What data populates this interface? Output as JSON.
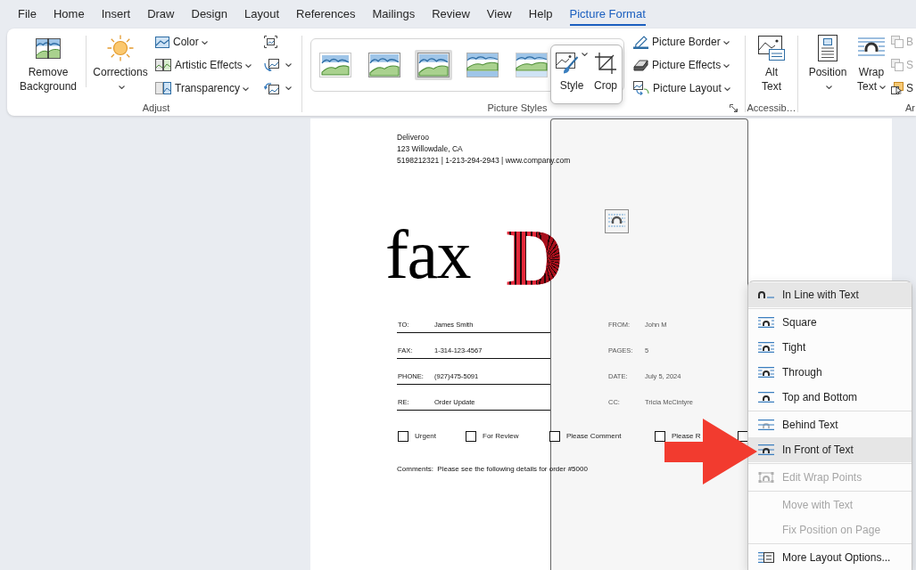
{
  "tabs": [
    {
      "label": "File",
      "selected": false
    },
    {
      "label": "Home",
      "selected": false
    },
    {
      "label": "Insert",
      "selected": false
    },
    {
      "label": "Draw",
      "selected": false
    },
    {
      "label": "Design",
      "selected": false
    },
    {
      "label": "Layout",
      "selected": false
    },
    {
      "label": "References",
      "selected": false
    },
    {
      "label": "Mailings",
      "selected": false
    },
    {
      "label": "Review",
      "selected": false
    },
    {
      "label": "View",
      "selected": false
    },
    {
      "label": "Help",
      "selected": false
    },
    {
      "label": "Picture Format",
      "selected": true
    }
  ],
  "ribbon": {
    "adjust": {
      "title": "Adjust",
      "large_buttons": [
        {
          "label": "Remove Background",
          "dropdown": false
        },
        {
          "label": "Corrections",
          "dropdown": true
        }
      ],
      "small_buttons": [
        {
          "label": "Color",
          "dropdown": true
        },
        {
          "label": "Artistic Effects",
          "dropdown": true
        },
        {
          "label": "Transparency",
          "dropdown": true
        }
      ],
      "icon_buttons": [
        {
          "dropdown": false
        },
        {
          "dropdown": true
        },
        {
          "dropdown": true
        }
      ]
    },
    "picture_styles": {
      "title": "Picture Styles",
      "gallery": [
        {
          "selected": false
        },
        {
          "selected": false
        },
        {
          "selected": true
        },
        {
          "selected": false
        },
        {
          "selected": false
        }
      ],
      "small_buttons": [
        {
          "label": "Picture Border",
          "dropdown": true
        },
        {
          "label": "Picture Effects",
          "dropdown": true
        },
        {
          "label": "Picture Layout",
          "dropdown": true
        }
      ]
    },
    "accessibility": {
      "title": "Accessib…",
      "large_buttons": [
        {
          "label": "Alt Text",
          "dropdown": false
        }
      ]
    },
    "arrange": {
      "title": "Ar",
      "large_buttons": [
        {
          "label": "Position",
          "dropdown": true
        },
        {
          "label": "Wrap Text",
          "dropdown": true
        }
      ],
      "small_buttons": [
        {
          "label": "B",
          "disabled": true
        },
        {
          "label": "S",
          "disabled": true
        },
        {
          "label": "S",
          "disabled": false
        }
      ]
    }
  },
  "quick_popup": {
    "buttons": [
      {
        "label": "Style",
        "dropdown": true
      },
      {
        "label": "Crop",
        "dropdown": false
      }
    ]
  },
  "document": {
    "sender_lines": [
      "Deliveroo",
      "123 Willowdale, CA",
      "5198212321 | 1-213-294-2943 | www.company.com"
    ],
    "title": "fax",
    "logo_letter": "D",
    "fields_left": [
      {
        "label": "TO:",
        "value": "James Smith"
      },
      {
        "label": "FAX:",
        "value": "1-314-123-4567"
      },
      {
        "label": "PHONE:",
        "value": "(927)475-5091"
      },
      {
        "label": "RE:",
        "value": "Order Update"
      }
    ],
    "fields_right": [
      {
        "label": "FROM:",
        "value": "John M"
      },
      {
        "label": "PAGES:",
        "value": "5"
      },
      {
        "label": "DATE:",
        "value": "July 5, 2024"
      },
      {
        "label": "CC:",
        "value": "Tricia McCintyre"
      }
    ],
    "checkboxes": [
      {
        "label": "Urgent",
        "checked": false
      },
      {
        "label": "For Review",
        "checked": false
      },
      {
        "label": "Please Comment",
        "checked": false
      },
      {
        "label": "Please R",
        "checked": false
      },
      {
        "checked": false
      }
    ],
    "comments": "Comments:  Please see the following details for order #5000"
  },
  "wrap_menu": {
    "sections": [
      {
        "items": [
          {
            "label": "In Line with Text",
            "highlighted": true,
            "disabled": false
          }
        ]
      },
      {
        "items": [
          {
            "label": "Square",
            "highlighted": false,
            "disabled": false
          },
          {
            "label": "Tight",
            "highlighted": false,
            "disabled": false
          },
          {
            "label": "Through",
            "highlighted": false,
            "disabled": false
          },
          {
            "label": "Top and Bottom",
            "highlighted": false,
            "disabled": false
          }
        ]
      },
      {
        "items": [
          {
            "label": "Behind Text",
            "highlighted": false,
            "disabled": false
          },
          {
            "label": "In Front of Text",
            "highlighted": true,
            "disabled": false
          }
        ]
      },
      {
        "items": [
          {
            "label": "Edit Wrap Points",
            "highlighted": false,
            "disabled": true
          }
        ]
      },
      {
        "items": [
          {
            "label": "Move with Text",
            "highlighted": false,
            "disabled": true
          },
          {
            "label": "Fix Position on Page",
            "highlighted": false,
            "disabled": true
          }
        ]
      },
      {
        "items": [
          {
            "label": "More Layout Options...",
            "highlighted": false,
            "disabled": false
          }
        ]
      }
    ]
  }
}
